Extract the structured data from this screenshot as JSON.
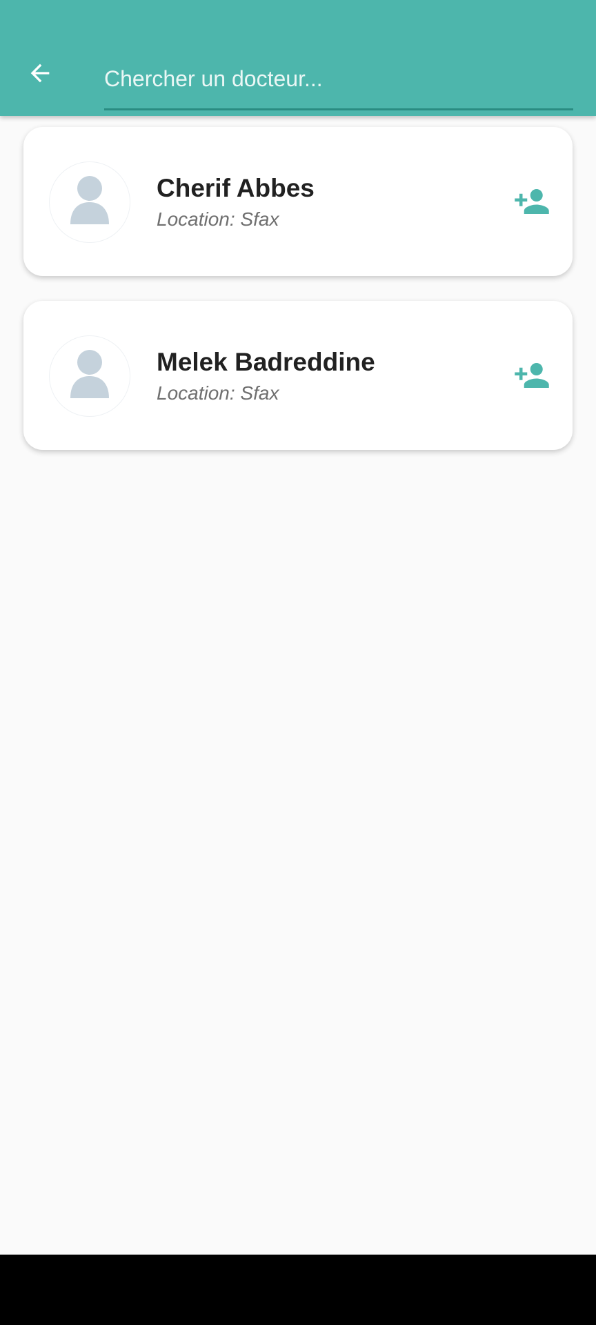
{
  "header": {
    "back_icon": "arrow-back-icon",
    "search": {
      "value": "",
      "placeholder": "Chercher un docteur..."
    }
  },
  "doctors": [
    {
      "name": "Cherif Abbes",
      "location": "Location: Sfax",
      "avatar_icon": "person-placeholder-icon",
      "action_icon": "person-add-icon"
    },
    {
      "name": "Melek Badreddine",
      "location": "Location: Sfax",
      "avatar_icon": "person-placeholder-icon",
      "action_icon": "person-add-icon"
    }
  ],
  "colors": {
    "primary": "#4db6ac",
    "primary_dark": "#2a8c82",
    "avatar_placeholder": "#c5d2dc",
    "background": "#fafafa",
    "text_primary": "#212121",
    "text_secondary": "#6f6f6f"
  }
}
